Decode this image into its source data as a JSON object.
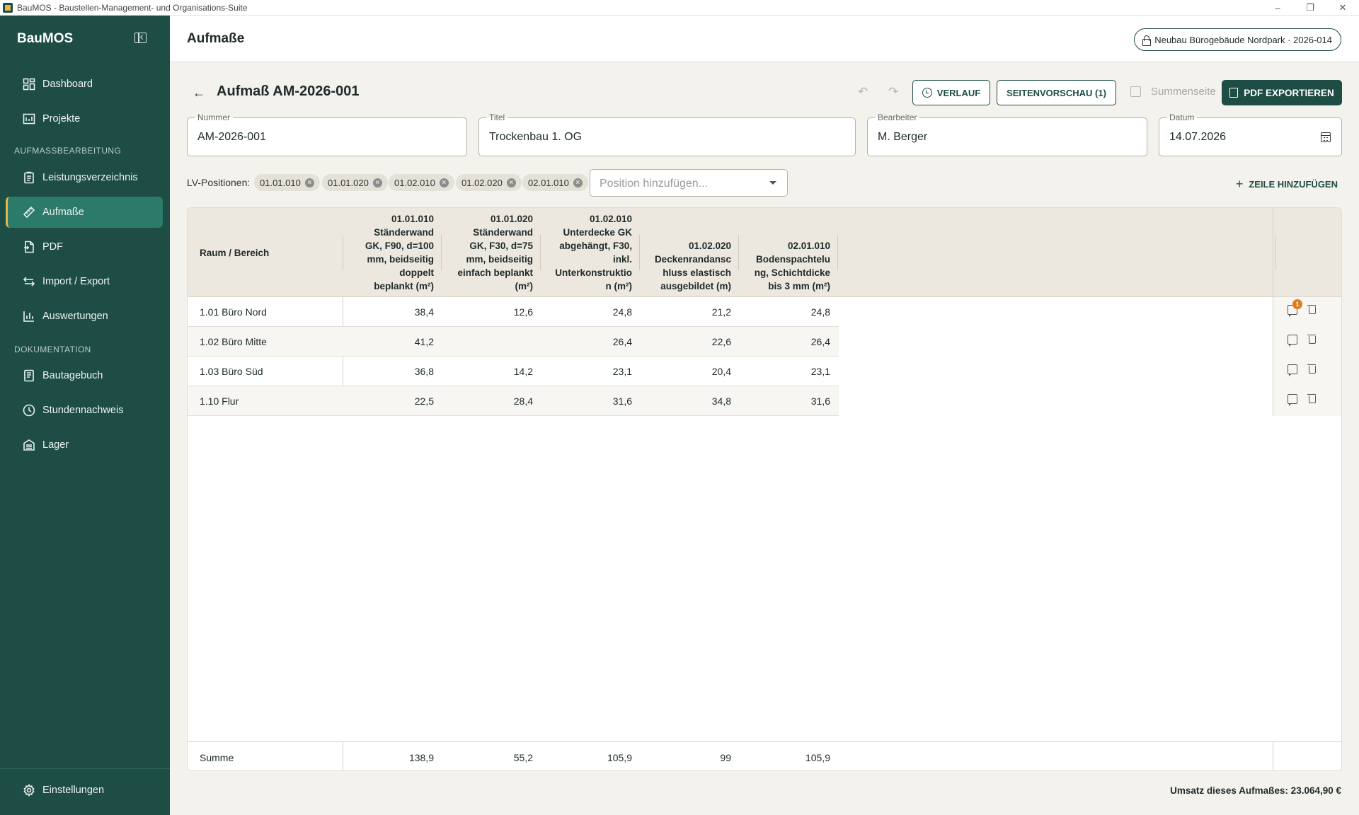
{
  "window": {
    "title": "BauMOS - Baustellen-Management- und Organisations-Suite",
    "minimize_icon": "minimize-icon",
    "restore_icon": "restore-icon",
    "close_icon": "close-icon"
  },
  "sidebar": {
    "brand": "BauMOS",
    "items_top": [
      {
        "label": "Dashboard",
        "icon": "dashboard-icon"
      },
      {
        "label": "Projekte",
        "icon": "projects-icon"
      }
    ],
    "section_1": "AUFMASSBEARBEITUNG",
    "items_1": [
      {
        "label": "Leistungsverzeichnis",
        "icon": "clipboard-icon"
      },
      {
        "label": "Aufmaße",
        "icon": "ruler-icon",
        "active": true
      },
      {
        "label": "PDF",
        "icon": "pdf-icon"
      },
      {
        "label": "Import / Export",
        "icon": "import-export-icon"
      },
      {
        "label": "Auswertungen",
        "icon": "chart-icon"
      }
    ],
    "section_2": "DOKUMENTATION",
    "items_2": [
      {
        "label": "Bautagebuch",
        "icon": "diary-icon"
      },
      {
        "label": "Stundennachweis",
        "icon": "clock-icon"
      },
      {
        "label": "Lager",
        "icon": "warehouse-icon"
      }
    ],
    "settings": {
      "label": "Einstellungen",
      "icon": "gear-icon"
    }
  },
  "header": {
    "title": "Aufmaße",
    "project": "Neubau Bürogebäude Nordpark · 2026-014"
  },
  "toolbar": {
    "doc_title": "Aufmaß AM-2026-001",
    "back": "←",
    "undo": "↶",
    "redo": "↷",
    "verlauf": "VERLAUF",
    "vorschau": "SEITENVORSCHAU (1)",
    "summenseite": "Summenseite",
    "pdf_export": "PDF EXPORTIEREN"
  },
  "fields": {
    "nummer": {
      "label": "Nummer",
      "value": "AM-2026-001"
    },
    "titel": {
      "label": "Titel",
      "value": "Trockenbau 1. OG"
    },
    "bearbeiter": {
      "label": "Bearbeiter",
      "value": "M. Berger"
    },
    "datum": {
      "label": "Datum",
      "value": "14.07.2026"
    }
  },
  "positions": {
    "label": "LV-Positionen:",
    "chips": [
      "01.01.010",
      "01.01.020",
      "01.02.010",
      "01.02.020",
      "02.01.010"
    ],
    "add_placeholder": "Position hinzufügen...",
    "add_row": "ZEILE HINZUFÜGEN"
  },
  "table": {
    "room_header": "Raum / Bereich",
    "columns": [
      [
        "01.01.010",
        "Ständerwand",
        "GK, F90, d=100",
        "mm, beidseitig",
        "doppelt",
        "beplankt (m²)"
      ],
      [
        "01.01.020",
        "Ständerwand",
        "GK, F30, d=75",
        "mm, beidseitig",
        "einfach beplankt",
        "(m²)"
      ],
      [
        "01.02.010",
        "Unterdecke GK",
        "abgehängt, F30,",
        "inkl.",
        "Unterkonstruktio",
        "n (m²)"
      ],
      [
        "01.02.020",
        "Deckenrandansc",
        "hluss elastisch",
        "ausgebildet (m)"
      ],
      [
        "02.01.010",
        "Bodenspachtelu",
        "ng, Schichtdicke",
        "bis 3 mm (m²)"
      ]
    ],
    "rows": [
      {
        "room": "1.01 Büro Nord",
        "values": [
          "38,4",
          "12,6",
          "24,8",
          "21,2",
          "24,8"
        ],
        "comments": "1"
      },
      {
        "room": "1.02 Büro Mitte",
        "values": [
          "41,2",
          "",
          "26,4",
          "22,6",
          "26,4"
        ]
      },
      {
        "room": "1.03 Büro Süd",
        "values": [
          "36,8",
          "14,2",
          "23,1",
          "20,4",
          "23,1"
        ]
      },
      {
        "room": "1.10 Flur",
        "values": [
          "22,5",
          "28,4",
          "31,6",
          "34,8",
          "31,6"
        ]
      }
    ],
    "sum": {
      "label": "Summe",
      "values": [
        "138,9",
        "55,2",
        "105,9",
        "99",
        "105,9"
      ]
    }
  },
  "footer": {
    "umsatz": "Umsatz dieses Aufmaßes: 23.064,90 €"
  },
  "colors": {
    "sidebar": "#1e4d45",
    "active_item": "#2c7a6a",
    "accent": "#e9b44c",
    "badge": "#e07b1a"
  }
}
